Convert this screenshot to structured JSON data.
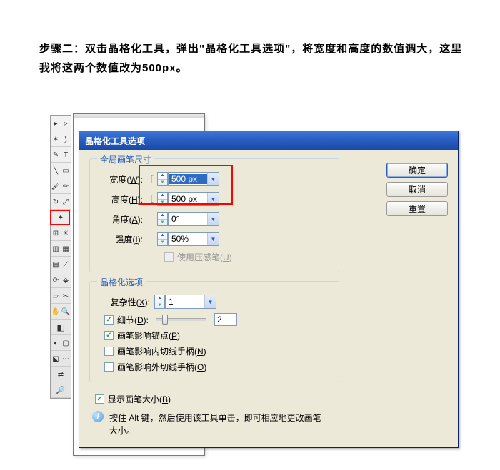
{
  "instruction": "步骤二：双击晶格化工具，弹出\"晶格化工具选项\"，将宽度和高度的数值调大，这里我将这两个数值改为500px。",
  "dialog": {
    "title": "晶格化工具选项",
    "buttons": {
      "ok": "确定",
      "cancel": "取消",
      "reset": "重置"
    }
  },
  "brush": {
    "legend": "全局画笔尺寸",
    "width_label": "宽度(W):",
    "width_value": "500 px",
    "height_label": "高度(H):",
    "height_value": "500 px",
    "angle_label": "角度(A):",
    "angle_value": "0°",
    "intensity_label": "强度(I):",
    "intensity_value": "50%",
    "pressure_label": "使用压感笔(U)"
  },
  "crystallize": {
    "legend": "晶格化选项",
    "complexity_label": "复杂性(X):",
    "complexity_value": "1",
    "detail_label": "细节(D):",
    "detail_value": "2",
    "anchor_label": "画笔影响锚点(P)",
    "intan_label": "画笔影响内切线手柄(N)",
    "outtan_label": "画笔影响外切线手柄(O)"
  },
  "showsize": {
    "label": "显示画笔大小(B)",
    "tip": "按住 Alt 键，然后使用该工具单击，即可相应地更改画笔大小。"
  },
  "chart_data": null
}
